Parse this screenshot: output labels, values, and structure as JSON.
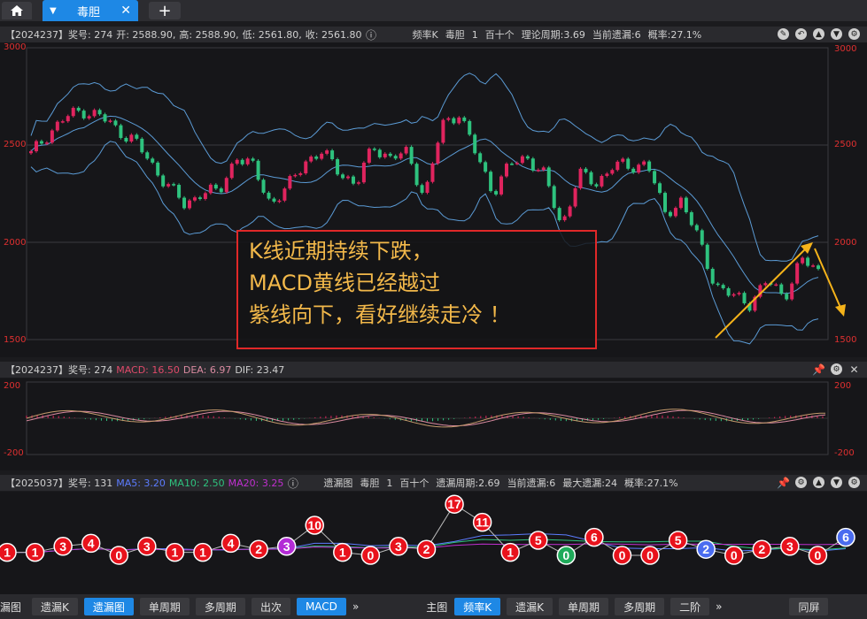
{
  "tabs": {
    "main_label": "毒胆"
  },
  "kline": {
    "issue_label": "【2024237】奖号: 274",
    "open": "开: 2588.90,",
    "high": "高: 2588.90,",
    "low": "低: 2561.80,",
    "close": "收: 2561.80",
    "mode": "频率K",
    "name": "毒胆",
    "count": "1",
    "digit": "百十个",
    "theory": "理论周期:3.69",
    "current": "当前遗漏:6",
    "prob": "概率:27.1%",
    "y_ticks": [
      "3000",
      "2500",
      "2000",
      "1500"
    ]
  },
  "callout": {
    "line1": "K线近期持续下跌，",
    "line2": "MACD黄线已经越过",
    "line3": "紫线向下，看好继续走冷 ！"
  },
  "macd": {
    "issue_label": "【2024237】奖号: 274",
    "macd": "MACD: 16.50",
    "dea": "DEA: 6.97",
    "dif": "DIF: 23.47",
    "y_ticks": [
      "200",
      "-200"
    ]
  },
  "omit": {
    "issue_label": "【2025037】奖号: 131",
    "ma5": "MA5: 3.20",
    "ma10": "MA10: 2.50",
    "ma20": "MA20: 3.25",
    "mode": "遗漏图",
    "name": "毒胆",
    "count": "1",
    "digit": "百十个",
    "omit_period": "遗漏周期:2.69",
    "current": "当前遗漏:6",
    "max": "最大遗漏:24",
    "prob": "概率:27.1%",
    "bubbles": [
      1,
      1,
      3,
      4,
      0,
      3,
      1,
      1,
      4,
      2,
      3,
      10,
      1,
      0,
      3,
      2,
      17,
      11,
      1,
      5,
      0,
      6,
      0,
      0,
      5,
      2,
      0,
      2,
      3,
      0,
      6
    ]
  },
  "bottom_left": {
    "cut": "漏图",
    "b1": "遗漏K",
    "b2": "遗漏图",
    "b3": "单周期",
    "b4": "多周期",
    "b5": "出次",
    "b6": "MACD"
  },
  "bottom_right": {
    "main": "主图",
    "b1": "频率K",
    "b2": "遗漏K",
    "b3": "单周期",
    "b4": "多周期",
    "b5": "二阶",
    "b6": "同屏"
  },
  "chart_data": [
    {
      "type": "candlestick",
      "title": "",
      "ylim": [
        1500,
        3000
      ],
      "y_ticks": [
        3000,
        2500,
        2000,
        1500
      ],
      "close_trend": [
        2450,
        2560,
        2640,
        2680,
        2650,
        2580,
        2530,
        2400,
        2300,
        2180,
        2270,
        2250,
        2450,
        2380,
        2200,
        2280,
        2420,
        2460,
        2370,
        2290,
        2500,
        2430,
        2460,
        2230,
        2600,
        2670,
        2450,
        2260,
        2400,
        2440,
        2340,
        2080,
        2350,
        2300,
        2400,
        2380,
        2420,
        2140,
        2220,
        2010,
        1780,
        1720,
        1690,
        1800,
        1720,
        1910,
        1850
      ],
      "up_color": "#e0245e",
      "down_color": "#2ec27e",
      "band_color": "#5b9bd5"
    },
    {
      "type": "line",
      "title": "",
      "ylim": [
        -200,
        200
      ],
      "y_ticks": [
        200,
        -200
      ],
      "series": [
        {
          "name": "MACD",
          "color": "#e04a6a"
        },
        {
          "name": "DEA",
          "color": "#d98aa0"
        },
        {
          "name": "DIF",
          "color": "#d0d0d0"
        }
      ]
    },
    {
      "type": "bubble-line",
      "title": "",
      "series": [
        {
          "name": "MA5",
          "color": "#5c7cff"
        },
        {
          "name": "MA10",
          "color": "#2ec27e"
        },
        {
          "name": "MA20",
          "color": "#c02fd0"
        }
      ]
    }
  ]
}
